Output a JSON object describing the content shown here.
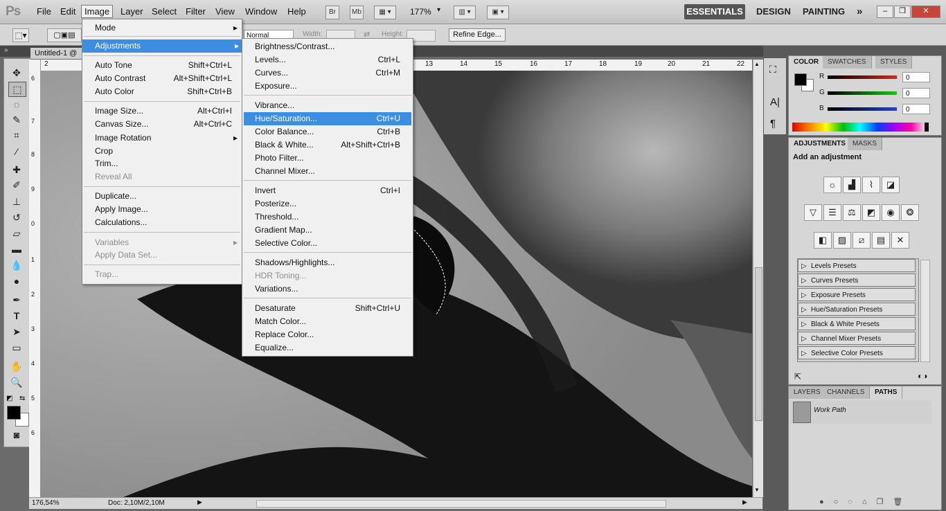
{
  "app": {
    "logo": "Ps"
  },
  "menubar": {
    "items": [
      "File",
      "Edit",
      "Image",
      "Layer",
      "Select",
      "Filter",
      "View",
      "Window",
      "Help"
    ],
    "buttons": {
      "br": "Br",
      "mb": "Mb"
    },
    "zoom": "177%",
    "workspaces": [
      "ESSENTIALS",
      "DESIGN",
      "PAINTING"
    ],
    "more": "»"
  },
  "options": {
    "style_value": "Normal",
    "width_label": "Width:",
    "height_label": "Height:",
    "refine_edge": "Refine Edge..."
  },
  "document": {
    "tab_title": "Untitled-1 @",
    "ruler_top": [
      "2",
      "13",
      "14",
      "15",
      "16",
      "17",
      "18",
      "19",
      "20",
      "21",
      "22"
    ],
    "ruler_left": [
      "6",
      "7",
      "8",
      "9",
      "0",
      "1",
      "2",
      "3",
      "4",
      "5",
      "6"
    ]
  },
  "status": {
    "zoom": "176,54%",
    "doc": "Doc: 2,10M/2,10M"
  },
  "image_menu": {
    "items": [
      {
        "label": "Mode",
        "submenu": true
      },
      {
        "sep": true
      },
      {
        "label": "Adjustments",
        "submenu": true,
        "highlight": true
      },
      {
        "sep": true
      },
      {
        "label": "Auto Tone",
        "shortcut": "Shift+Ctrl+L"
      },
      {
        "label": "Auto Contrast",
        "shortcut": "Alt+Shift+Ctrl+L"
      },
      {
        "label": "Auto Color",
        "shortcut": "Shift+Ctrl+B"
      },
      {
        "sep": true
      },
      {
        "label": "Image Size...",
        "shortcut": "Alt+Ctrl+I"
      },
      {
        "label": "Canvas Size...",
        "shortcut": "Alt+Ctrl+C"
      },
      {
        "label": "Image Rotation",
        "submenu": true
      },
      {
        "label": "Crop"
      },
      {
        "label": "Trim..."
      },
      {
        "label": "Reveal All",
        "disabled": true
      },
      {
        "sep": true
      },
      {
        "label": "Duplicate..."
      },
      {
        "label": "Apply Image..."
      },
      {
        "label": "Calculations..."
      },
      {
        "sep": true
      },
      {
        "label": "Variables",
        "submenu": true,
        "disabled": true
      },
      {
        "label": "Apply Data Set...",
        "disabled": true
      },
      {
        "sep": true
      },
      {
        "label": "Trap...",
        "disabled": true
      }
    ]
  },
  "adjustments_menu": {
    "items": [
      {
        "label": "Brightness/Contrast..."
      },
      {
        "label": "Levels...",
        "shortcut": "Ctrl+L"
      },
      {
        "label": "Curves...",
        "shortcut": "Ctrl+M"
      },
      {
        "label": "Exposure..."
      },
      {
        "sep": true
      },
      {
        "label": "Vibrance..."
      },
      {
        "label": "Hue/Saturation...",
        "shortcut": "Ctrl+U",
        "highlight": true
      },
      {
        "label": "Color Balance...",
        "shortcut": "Ctrl+B"
      },
      {
        "label": "Black & White...",
        "shortcut": "Alt+Shift+Ctrl+B"
      },
      {
        "label": "Photo Filter..."
      },
      {
        "label": "Channel Mixer..."
      },
      {
        "sep": true
      },
      {
        "label": "Invert",
        "shortcut": "Ctrl+I"
      },
      {
        "label": "Posterize..."
      },
      {
        "label": "Threshold..."
      },
      {
        "label": "Gradient Map..."
      },
      {
        "label": "Selective Color..."
      },
      {
        "sep": true
      },
      {
        "label": "Shadows/Highlights..."
      },
      {
        "label": "HDR Toning...",
        "disabled": true
      },
      {
        "label": "Variations..."
      },
      {
        "sep": true
      },
      {
        "label": "Desaturate",
        "shortcut": "Shift+Ctrl+U"
      },
      {
        "label": "Match Color..."
      },
      {
        "label": "Replace Color..."
      },
      {
        "label": "Equalize..."
      }
    ]
  },
  "color_panel": {
    "tabs": [
      "COLOR",
      "SWATCHES",
      "STYLES"
    ],
    "channels": [
      {
        "label": "R",
        "value": "0",
        "color": "#e02020"
      },
      {
        "label": "G",
        "value": "0",
        "color": "#20c020"
      },
      {
        "label": "B",
        "value": "0",
        "color": "#2040e0"
      }
    ]
  },
  "adjustments_panel": {
    "tabs": [
      "ADJUSTMENTS",
      "MASKS"
    ],
    "heading": "Add an adjustment",
    "presets": [
      "Levels Presets",
      "Curves Presets",
      "Exposure Presets",
      "Hue/Saturation Presets",
      "Black & White Presets",
      "Channel Mixer Presets",
      "Selective Color Presets"
    ]
  },
  "layers_panel": {
    "tabs": [
      "LAYERS",
      "CHANNELS",
      "PATHS"
    ],
    "paths": [
      "Work Path"
    ]
  },
  "colors": {
    "accent": "#3d8ee0",
    "highlight_text": "#ffffff"
  }
}
